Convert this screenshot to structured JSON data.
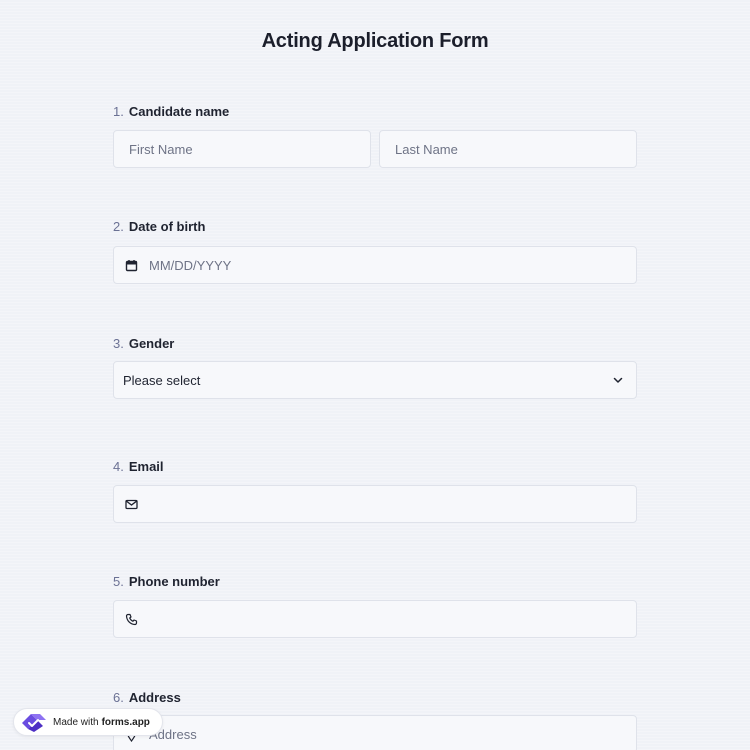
{
  "form": {
    "title": "Acting Application Form"
  },
  "questions": [
    {
      "number": "1.",
      "label": "Candidate name",
      "fields": {
        "first_placeholder": "First Name",
        "last_placeholder": "Last Name"
      }
    },
    {
      "number": "2.",
      "label": "Date of birth",
      "placeholder": "MM/DD/YYYY",
      "icon": "calendar-icon"
    },
    {
      "number": "3.",
      "label": "Gender",
      "selected": "Please select",
      "icon": "chevron-down-icon"
    },
    {
      "number": "4.",
      "label": "Email",
      "value": "",
      "icon": "mail-icon"
    },
    {
      "number": "5.",
      "label": "Phone number",
      "value": "",
      "icon": "phone-icon"
    },
    {
      "number": "6.",
      "label": "Address",
      "placeholder": "Address",
      "icon": "location-pin-icon"
    }
  ],
  "badge": {
    "prefix": "Made with",
    "brand": "forms.app"
  },
  "colors": {
    "background": "#f0f2f7",
    "field_border": "#dfe2ea",
    "number_color": "#6b7194",
    "brand_purple": "#6a4ce0"
  }
}
